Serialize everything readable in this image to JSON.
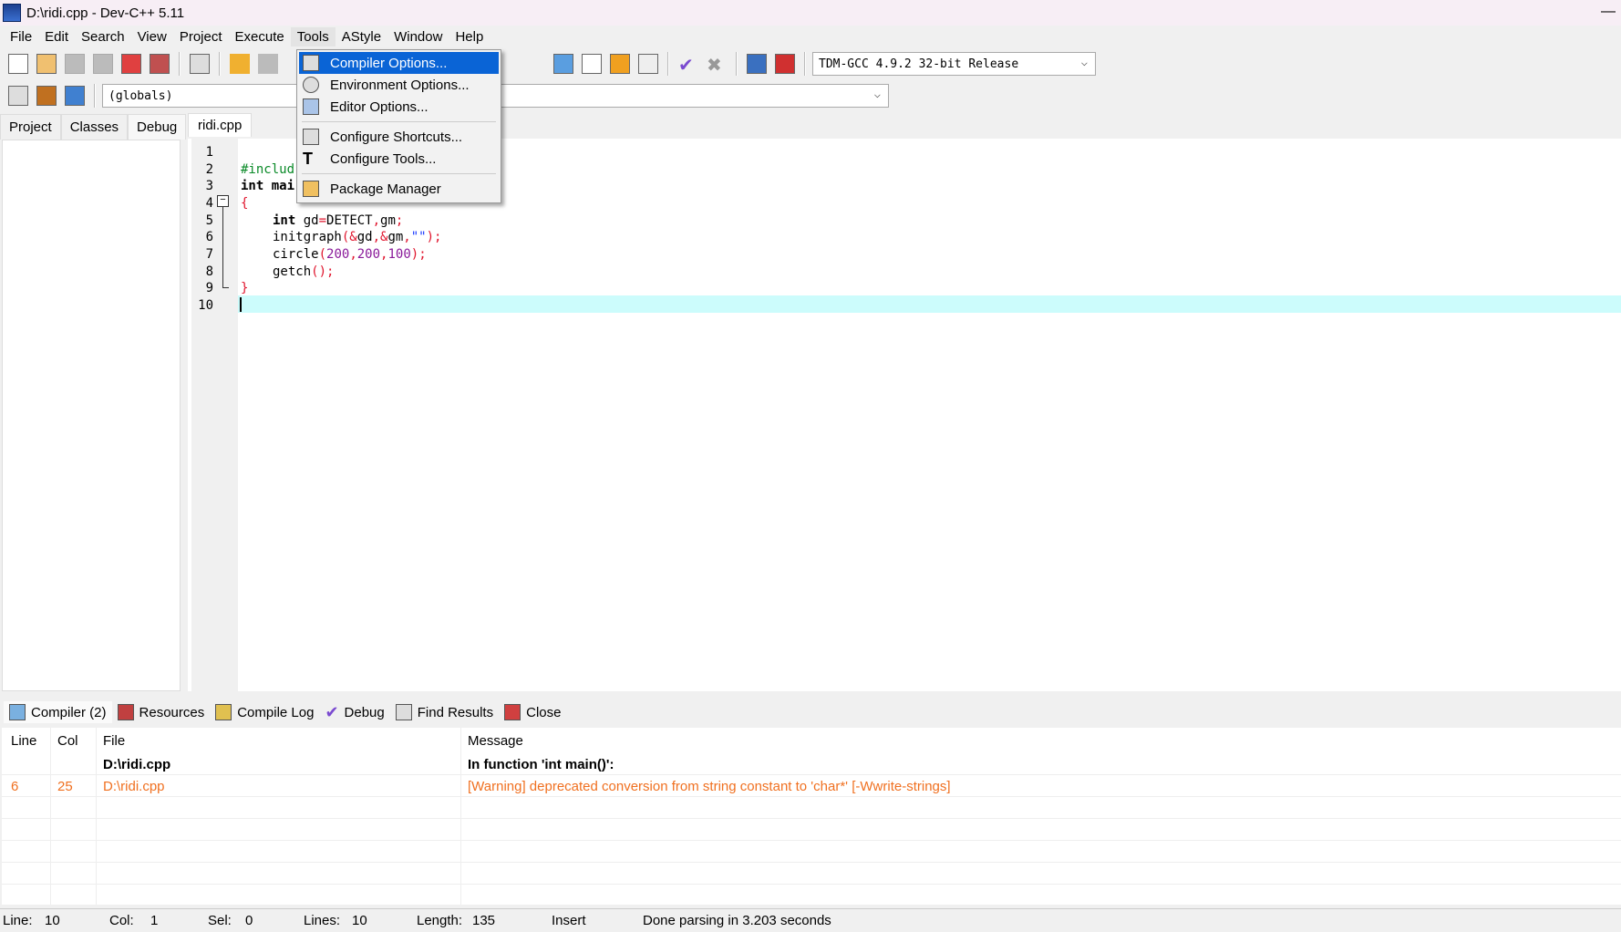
{
  "window": {
    "title": "D:\\ridi.cpp - Dev-C++ 5.11"
  },
  "menubar": [
    "File",
    "Edit",
    "Search",
    "View",
    "Project",
    "Execute",
    "Tools",
    "AStyle",
    "Window",
    "Help"
  ],
  "toolbar": {
    "compiler_select": "TDM-GCC 4.9.2 32-bit Release",
    "scope_select": "(globals)",
    "function_select": ""
  },
  "left_tabs": [
    "Project",
    "Classes",
    "Debug"
  ],
  "editor_tab": "ridi.cpp",
  "tools_menu": [
    {
      "label": "Compiler Options...",
      "icon": "compiler-options-icon",
      "highlighted": true
    },
    {
      "label": "Environment Options...",
      "icon": "environment-options-icon"
    },
    {
      "label": "Editor Options...",
      "icon": "editor-options-icon"
    },
    {
      "label": "Configure Shortcuts...",
      "icon": "shortcuts-icon"
    },
    {
      "label": "Configure Tools...",
      "icon": "hammer-icon"
    },
    {
      "label": "Package Manager",
      "icon": "package-icon"
    }
  ],
  "code_lines": [
    "1",
    "2",
    "3",
    "4",
    "5",
    "6",
    "7",
    "8",
    "9",
    "10"
  ],
  "code": {
    "l2": "#includ",
    "l3a": "int",
    "l3b": " mai",
    "l4": "{",
    "l5a": "int",
    "l5b": " gd",
    "l5c": "=",
    "l5d": "DETECT",
    "l5e": ",",
    "l5f": "gm",
    "l5g": ";",
    "l6a": "initgraph",
    "l6b": "(&",
    "l6c": "gd",
    "l6d": ",&",
    "l6e": "gm",
    "l6f": ",",
    "l6g": "\"\"",
    "l6h": ");",
    "l7a": "circle",
    "l7b": "(",
    "l7c": "200",
    "l7d": ",",
    "l7e": "200",
    "l7f": ",",
    "l7g": "100",
    "l7h": ");",
    "l8a": "getch",
    "l8b": "();",
    "l9": "}"
  },
  "bottom_tabs": [
    {
      "label": "Compiler (2)",
      "icon": "compiler-icon"
    },
    {
      "label": "Resources",
      "icon": "resources-icon"
    },
    {
      "label": "Compile Log",
      "icon": "compile-log-icon"
    },
    {
      "label": "Debug",
      "icon": "debug-check-icon"
    },
    {
      "label": "Find Results",
      "icon": "find-icon"
    },
    {
      "label": "Close",
      "icon": "close-icon"
    }
  ],
  "messages": {
    "columns": [
      "Line",
      "Col",
      "File",
      "Message"
    ],
    "rows": [
      {
        "line": "",
        "col": "",
        "file": "D:\\ridi.cpp",
        "message": "In function 'int main()':"
      },
      {
        "line": "6",
        "col": "25",
        "file": "D:\\ridi.cpp",
        "message": "[Warning] deprecated conversion from string constant to 'char*' [-Wwrite-strings]"
      }
    ]
  },
  "status": {
    "line_label": "Line:",
    "line": "10",
    "col_label": "Col:",
    "col": "1",
    "sel_label": "Sel:",
    "sel": "0",
    "lines_label": "Lines:",
    "lines": "10",
    "length_label": "Length:",
    "length": "135",
    "mode": "Insert",
    "message": "Done parsing in 3.203 seconds"
  },
  "colors": {
    "highlight": "#0a64d6",
    "current_line": "#ccfcfc",
    "warning": "#f07020"
  }
}
